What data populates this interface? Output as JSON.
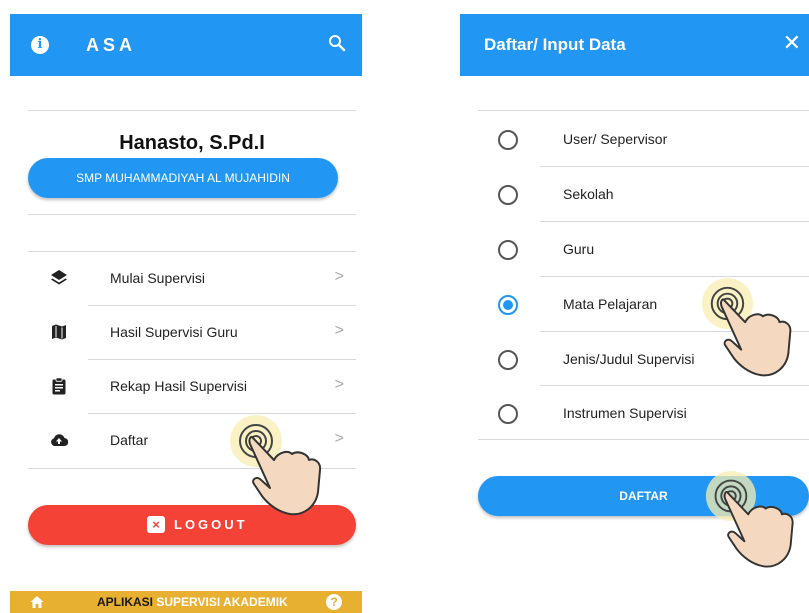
{
  "left_screen": {
    "app_title": "ASA",
    "user_name": "Hanasto, S.Pd.I",
    "school_button": "SMP MUHAMMADIYAH AL MUJAHIDIN",
    "menu": [
      {
        "label": "Mulai Supervisi",
        "icon": "layers-icon"
      },
      {
        "label": "Hasil Supervisi Guru",
        "icon": "map-icon"
      },
      {
        "label": "Rekap Hasil Supervisi",
        "icon": "clipboard-icon"
      },
      {
        "label": "Daftar",
        "icon": "cloud-upload-icon"
      }
    ],
    "logout_label": "LOGOUT",
    "footer": {
      "part1": "APLIKASI",
      "part2": "SUPERVISI AKADEMIK"
    }
  },
  "right_screen": {
    "dialog_title": "Daftar/ Input Data",
    "options": [
      {
        "label": "User/ Sepervisor",
        "selected": false
      },
      {
        "label": "Sekolah",
        "selected": false
      },
      {
        "label": "Guru",
        "selected": false
      },
      {
        "label": "Mata Pelajaran",
        "selected": true
      },
      {
        "label": "Jenis/Judul Supervisi",
        "selected": false
      },
      {
        "label": "Instrumen Supervisi",
        "selected": false
      }
    ],
    "submit_label": "DAFTAR"
  },
  "colors": {
    "primary": "#2196f3",
    "danger": "#f44336",
    "footer": "#e8b030"
  }
}
